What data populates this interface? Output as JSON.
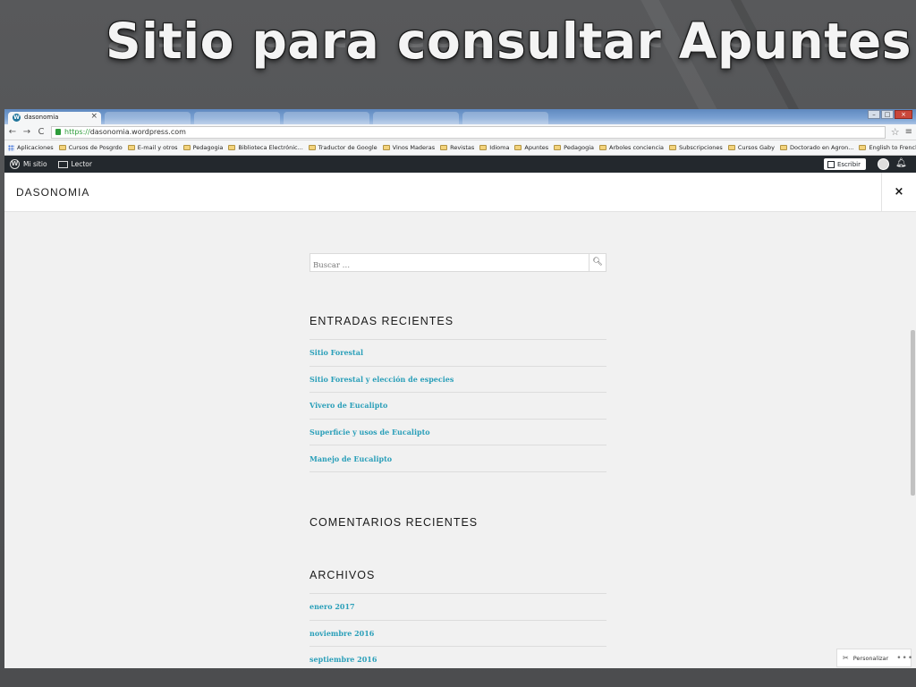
{
  "slide": {
    "title": "Sitio para consultar Apuntes"
  },
  "browser": {
    "active_tab": "dasonomia",
    "tab_close": "×",
    "url_scheme": "https://",
    "url_rest": "dasonomia.wordpress.com",
    "bookmarks": [
      {
        "label": "Aplicaciones",
        "icon": "apps-icon"
      },
      {
        "label": "Cursos de Posgrdo",
        "icon": "folder-icon"
      },
      {
        "label": "E-mail y otros",
        "icon": "folder-icon"
      },
      {
        "label": "Pedagogia",
        "icon": "folder-icon"
      },
      {
        "label": "Biblioteca Electrónic...",
        "icon": "page-icon"
      },
      {
        "label": "Traductor de Google",
        "icon": "translate-icon"
      },
      {
        "label": "Vinos Maderas",
        "icon": "folder-icon"
      },
      {
        "label": "Revistas",
        "icon": "folder-icon"
      },
      {
        "label": "Idioma",
        "icon": "folder-icon"
      },
      {
        "label": "Apuntes",
        "icon": "folder-icon"
      },
      {
        "label": "Pedagogia",
        "icon": "folder-icon"
      },
      {
        "label": "Arboles conciencia",
        "icon": "folder-icon"
      },
      {
        "label": "Subscripciones",
        "icon": "folder-icon"
      },
      {
        "label": "Cursos Gaby",
        "icon": "folder-icon"
      },
      {
        "label": "Doctorado en Agron...",
        "icon": "page-icon"
      },
      {
        "label": "English to French, It...",
        "icon": "page-icon"
      }
    ]
  },
  "wp_admin_bar": {
    "my_site": "Mi sitio",
    "reader": "Lector",
    "write": "Escribir"
  },
  "site": {
    "title": "DASONOMIA",
    "close": "×"
  },
  "sidebar": {
    "search_placeholder": "Buscar …",
    "recent_posts_title": "ENTRADAS RECIENTES",
    "recent_posts": [
      "Sitio Forestal",
      "Sitio Forestal y elección de especies",
      "Vivero de Eucalipto",
      "Superficie y usos de Eucalipto",
      "Manejo de Eucalipto"
    ],
    "recent_comments_title": "COMENTARIOS RECIENTES",
    "archives_title": "ARCHIVOS",
    "archives": [
      "enero 2017",
      "noviembre 2016",
      "septiembre 2016"
    ]
  },
  "customize": {
    "label": "Personalizar",
    "more": "•••"
  },
  "colors": {
    "link": "#2a9fb9",
    "admin_bar": "#23282d"
  }
}
